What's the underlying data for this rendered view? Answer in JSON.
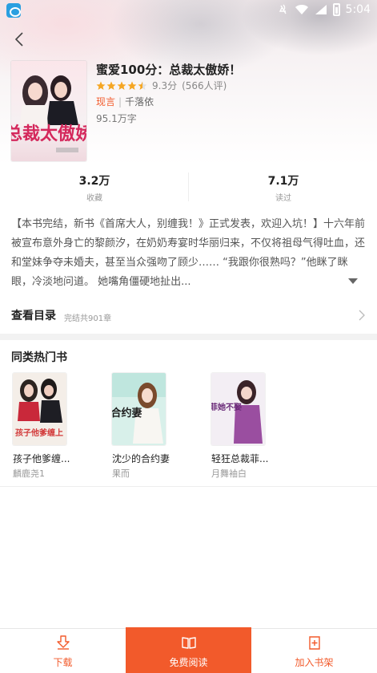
{
  "status_bar": {
    "time": "5:04"
  },
  "book": {
    "title": "蜜爱100分：总裁太傲娇！",
    "rating_score": "9.3分",
    "rating_count": "(566人评)",
    "rating_stars": 4.5,
    "genre": "现言",
    "author": "千落依",
    "word_count": "95.1万字",
    "cover_text": "总裁太傲娇"
  },
  "stats": [
    {
      "value": "3.2万",
      "label": "收藏"
    },
    {
      "value": "7.1万",
      "label": "读过"
    }
  ],
  "description": "【本书完结，新书《首席大人，别缠我！》正式发表，欢迎入坑！】十六年前被宣布意外身亡的黎颜汐，在奶奶寿宴时华丽归来，不仅将祖母气得吐血，还和堂妹争夺未婚夫，甚至当众强吻了顾少…… “我跟你很熟吗？”他眯了眯眼，冷淡地问道。 她嘴角僵硬地扯出...",
  "catalog": {
    "title": "查看目录",
    "subtitle": "完结共901章"
  },
  "similar": {
    "title": "同类热门书",
    "items": [
      {
        "name": "孩子他爹缠...",
        "author": "麟鹿尧1",
        "cover_text": "孩子他爹缠上"
      },
      {
        "name": "沈少的合约妻",
        "author": "果而",
        "cover_text": "合约妻"
      },
      {
        "name": "轻狂总裁菲...",
        "author": "月舞袖白",
        "cover_text": "菲她不娶"
      }
    ]
  },
  "bottom_bar": {
    "download": "下载",
    "read": "免费阅读",
    "add_shelf": "加入书架"
  },
  "colors": {
    "accent": "#f25a2b",
    "star": "#f5a623"
  }
}
